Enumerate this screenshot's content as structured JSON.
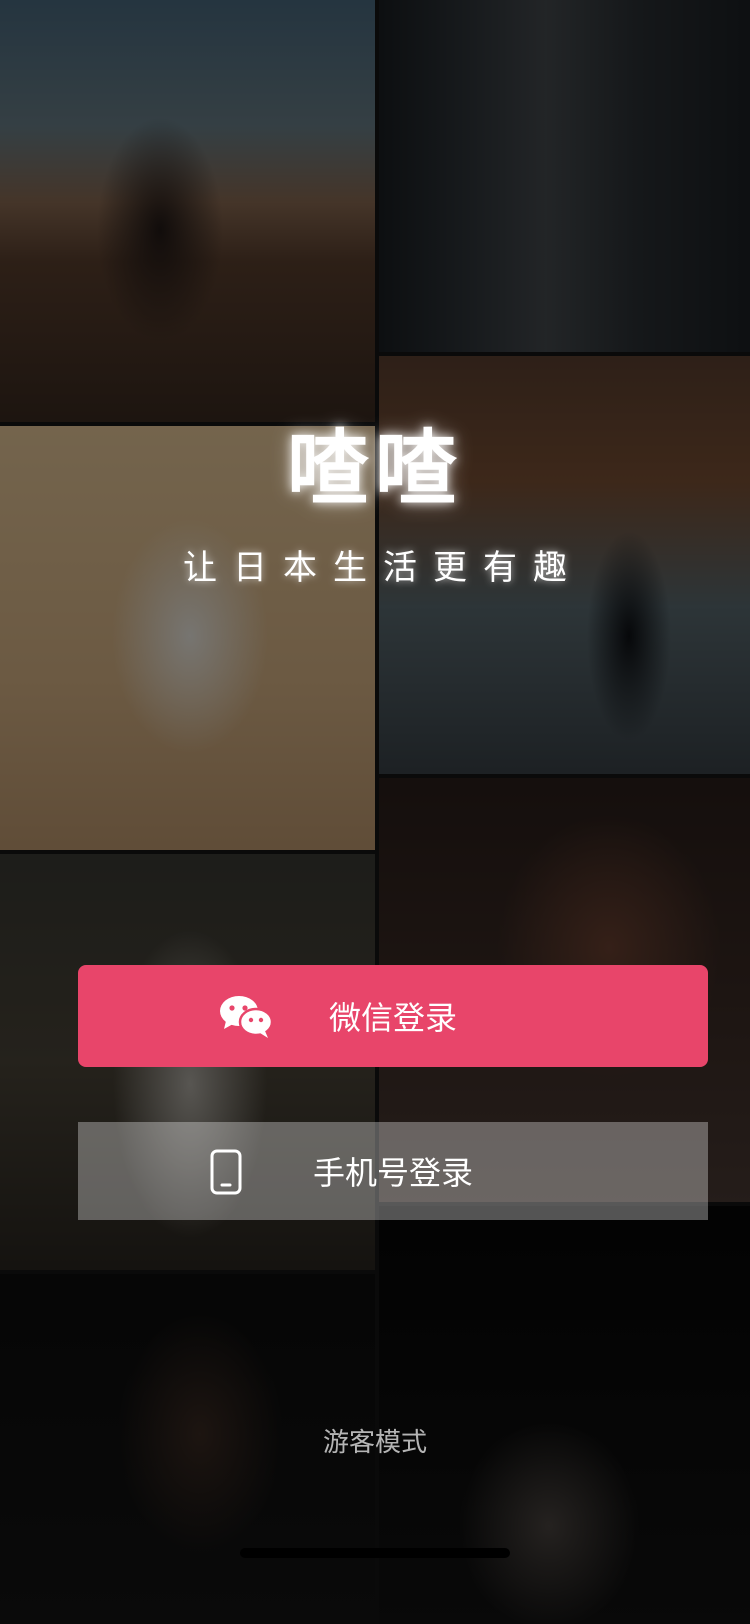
{
  "app": {
    "title": "喳喳",
    "tagline": "让日本生活更有趣"
  },
  "buttons": {
    "wechat_label": "微信登录",
    "phone_label": "手机号登录",
    "wechat_icon": "wechat-icon",
    "phone_icon": "smartphone-icon"
  },
  "guest": {
    "label": "游客模式"
  },
  "colors": {
    "accent": "#e8456a",
    "text": "#ffffff"
  }
}
